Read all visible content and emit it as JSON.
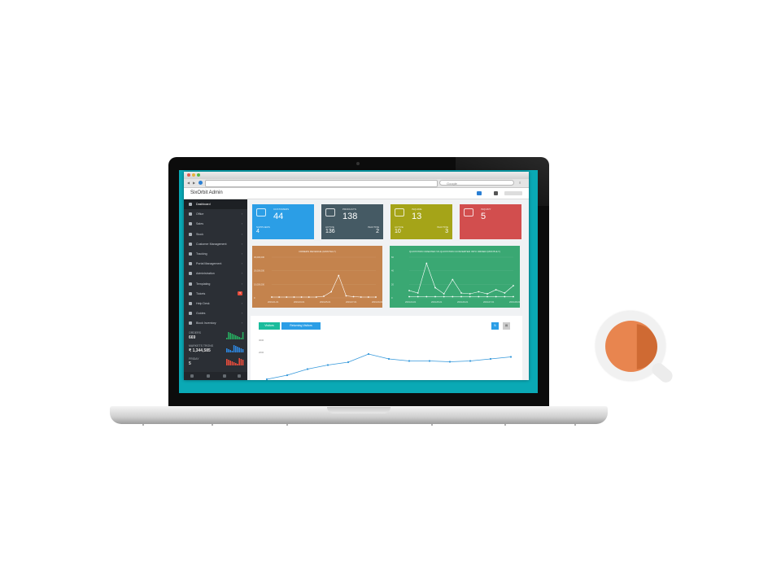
{
  "browser": {
    "search_placeholder": "Google"
  },
  "app": {
    "brand": "SixOrbit Admin"
  },
  "sidebar": {
    "items": [
      {
        "label": "Dashboard",
        "icon": "dashboard-icon",
        "active": true
      },
      {
        "label": "Office",
        "icon": "folder-icon"
      },
      {
        "label": "Sales",
        "icon": "truck-icon"
      },
      {
        "label": "Stock",
        "icon": "box-icon"
      },
      {
        "label": "Customer Management",
        "icon": "users-icon"
      },
      {
        "label": "Tracking",
        "icon": "share-icon"
      },
      {
        "label": "Portal Management",
        "icon": "monitor-icon"
      },
      {
        "label": "Administration",
        "icon": "gear-icon"
      },
      {
        "label": "Templating",
        "icon": "template-icon"
      },
      {
        "label": "Tickets",
        "icon": "ticket-icon",
        "badge": "5"
      },
      {
        "label": "Help Desk",
        "icon": "help-icon"
      },
      {
        "label": "Guides",
        "icon": "book-icon"
      },
      {
        "label": "Block Inventory",
        "icon": "block-icon"
      }
    ],
    "stats": [
      {
        "label": "ORDERS",
        "value": "669",
        "color": "#27ae60"
      },
      {
        "label": "MARKETS TRONS",
        "value": "₹ 1,344,585",
        "color": "#2e86de"
      },
      {
        "label": "FRIDAY",
        "value": "5",
        "color": "#e74c3c"
      }
    ]
  },
  "tiles": [
    {
      "label": "CUSTOMERS",
      "value": "44",
      "sub1_label": "SUPPLIERS",
      "sub1_value": "4",
      "sub2_label": "",
      "sub2_value": "",
      "color": "#2b9ee6",
      "icon": "users-icon"
    },
    {
      "label": "PRODUCTS",
      "value": "138",
      "sub1_label": "ACTIVE",
      "sub1_value": "136",
      "sub2_label": "INACTIVE",
      "sub2_value": "2",
      "color": "#455a64",
      "icon": "cart-icon"
    },
    {
      "label": "INQUIRE",
      "value": "13",
      "sub1_label": "ACTIVE",
      "sub1_value": "10",
      "sub2_label": "INACTIVE",
      "sub2_value": "3",
      "color": "#a5a418",
      "icon": "lifebuoy-icon"
    },
    {
      "label": "INQUIRY",
      "value": "5",
      "sub1_label": "",
      "sub1_value": "",
      "sub2_label": "",
      "sub2_value": "",
      "color": "#d24e4e",
      "icon": "question-icon"
    }
  ],
  "charts": {
    "revenue": {
      "title": "ORDERS REVENUE (MONTHLY)",
      "color": "#c4834d",
      "ylabels": [
        "30,000,000",
        "20,000,000",
        "10,000,000",
        "0"
      ],
      "xlabels": [
        "2019-01-01",
        "2019-03-01",
        "2019-05-01",
        "2019-07-01",
        "2019-09-01"
      ],
      "values": [
        0.02,
        0.02,
        0.02,
        0.02,
        0.02,
        0.02,
        0.02,
        0.04,
        0.15,
        0.55,
        0.05,
        0.03,
        0.02,
        0.02,
        0.02
      ]
    },
    "quotations": {
      "title": "QUOTATION CREATED VS QUOTATION CONVERTED INTO ORDER (MONTHLY)",
      "color": "#3aa873",
      "ylabels": [
        "60",
        "40",
        "20",
        "0"
      ],
      "xlabels": [
        "2019-04-01",
        "2019-05-01",
        "2019-06-01",
        "2019-07-01",
        "2019-08-01"
      ],
      "values": [
        0.18,
        0.12,
        0.85,
        0.25,
        0.1,
        0.45,
        0.12,
        0.1,
        0.15,
        0.1,
        0.2,
        0.12,
        0.3
      ],
      "values2": [
        0.03,
        0.03,
        0.03,
        0.03,
        0.03,
        0.03,
        0.03,
        0.03,
        0.03,
        0.03,
        0.03,
        0.03,
        0.03
      ]
    },
    "visitors": {
      "tab1": "Visitors",
      "tab2": "Returning Visitors",
      "toggle1": "⇅",
      "toggle2": "▤",
      "ylabels": [
        "3000",
        "2000"
      ],
      "values": [
        0.0,
        0.1,
        0.25,
        0.35,
        0.42,
        0.62,
        0.5,
        0.45,
        0.45,
        0.43,
        0.45,
        0.5,
        0.55
      ]
    }
  }
}
